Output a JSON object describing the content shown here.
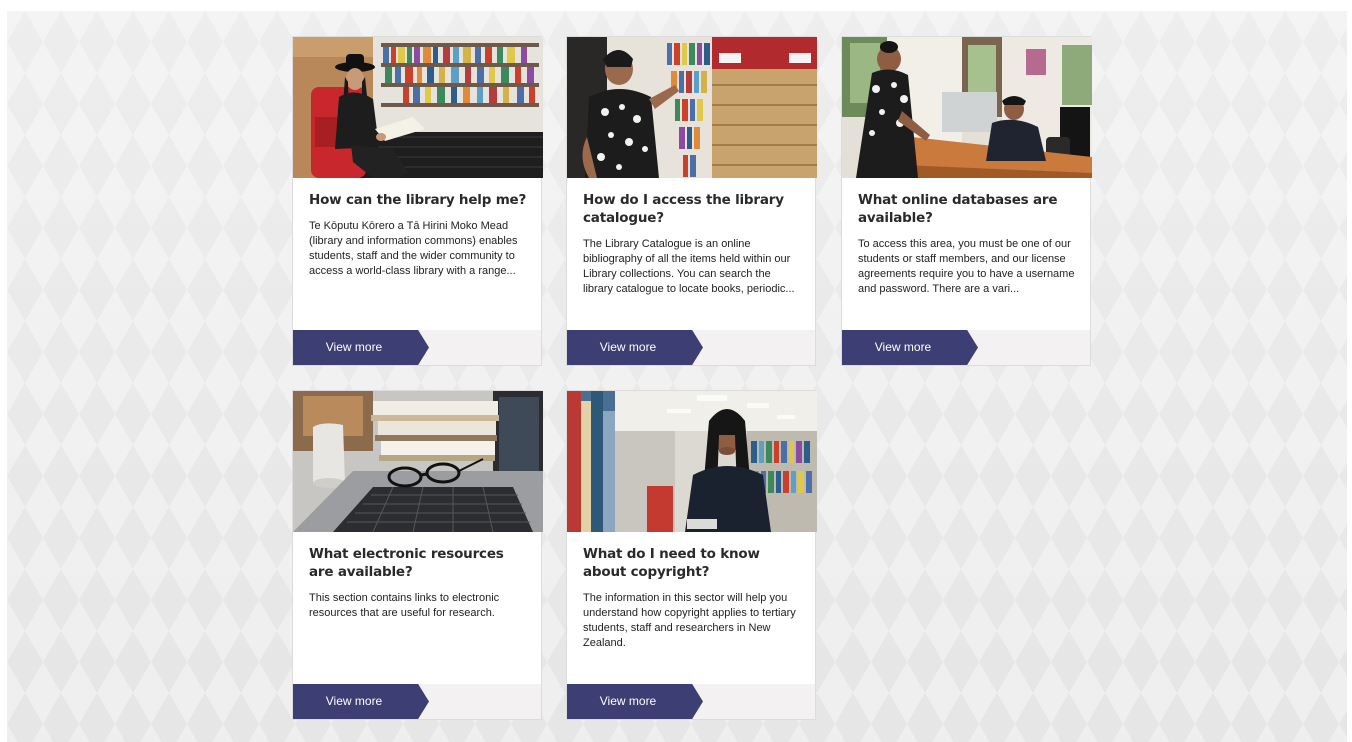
{
  "cards": [
    {
      "title": "How can the library help me?",
      "text": "Te Kōputu Kōrero a Tā Hirini Moko Mead (library and information commons) enables students, staff and the wider community to access a world-class library with a range...",
      "button": "View more",
      "image": "woman-reading-in-library-photo"
    },
    {
      "title": "How do I access the library catalogue?",
      "text": "The Library Catalogue is an online bibliography of all the items held within our Library collections. You can search the library catalogue to locate books, periodic...",
      "button": "View more",
      "image": "woman-at-bookshelf-photo"
    },
    {
      "title": "What online databases are available?",
      "text": "To access this area, you must be one of our students or staff members, and our license agreements require you to have a username and password. There are a vari...",
      "button": "View more",
      "image": "library-desk-photo"
    },
    {
      "title": "What electronic resources are available?",
      "text": "This section contains links to electronic resources that are useful for research.",
      "button": "View more",
      "image": "laptop-books-glasses-photo"
    },
    {
      "title": "What do I need to know about copyright?",
      "text": "The information in this sector will help you understand how copyright applies to tertiary students, staff and researchers in New Zealand.",
      "button": "View more",
      "image": "woman-in-library-aisle-photo"
    }
  ],
  "colors": {
    "button": "#3d3f74",
    "footer": "#f3f1f1",
    "background": "#ececec"
  }
}
